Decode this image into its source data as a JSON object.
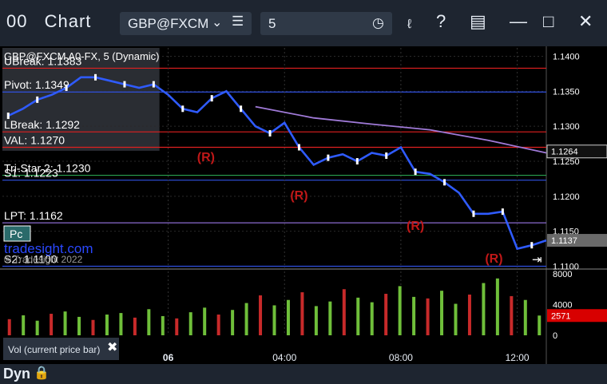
{
  "window": {
    "icon_label": "00",
    "title": "Chart"
  },
  "toolbar": {
    "symbol": "GBP@FXCM",
    "interval": "5"
  },
  "chart_header": {
    "top_line": "GBP@FXCM A0-FX, 5 (Dynamic)",
    "watermark": "tradesight.com",
    "copyright": "© Tradesight 2022",
    "pc_button": "Pc"
  },
  "levels": [
    {
      "label": "UBreak: 1.1383",
      "price": 1.1383,
      "color": "#e02020"
    },
    {
      "label": "Pivot: 1.1349",
      "price": 1.1349,
      "color": "#3050e0"
    },
    {
      "label": "LBreak: 1.1292",
      "price": 1.1292,
      "color": "#e02020"
    },
    {
      "label": "VAL: 1.1270",
      "price": 1.127,
      "color": "#e02020"
    },
    {
      "label": "Tri-Star 2: 1.1230",
      "price": 1.123,
      "color": "#2aa050"
    },
    {
      "label": "S1: 1.1223",
      "price": 1.1223,
      "color": "#3050e0"
    },
    {
      "label": "LPT: 1.1162",
      "price": 1.1162,
      "color": "#8a6ad0"
    },
    {
      "label": "S2: 1.1100",
      "price": 1.11,
      "color": "#3050e0"
    }
  ],
  "chart_data": {
    "type": "line",
    "price_axis": [
      1.14,
      1.135,
      1.13,
      1.125,
      1.12,
      1.115,
      1.11
    ],
    "price_axis_labels": [
      "1.1400",
      "1.1350",
      "1.1300",
      "1.1250",
      "1.1200",
      "1.1150",
      "1.1100"
    ],
    "ylim": [
      1.1096,
      1.1412
    ],
    "x_time_labels": [
      "06",
      "04:00",
      "08:00",
      "12:00"
    ],
    "x_label_hours": [
      0,
      4,
      8,
      12
    ],
    "x_range_hours": [
      -5.7,
      13
    ],
    "series": [
      {
        "values_x": [
          -5.5,
          -5,
          -4.5,
          -4,
          -3.5,
          -3,
          -2.5,
          -2,
          -1.5,
          -1,
          -0.5,
          0,
          0.5,
          1,
          1.5,
          2,
          2.5,
          3,
          3.5,
          4,
          4.5,
          5,
          5.5,
          6,
          6.5,
          7,
          7.5,
          8,
          8.5,
          9,
          9.5,
          10,
          10.5,
          11,
          11.5,
          12,
          12.5,
          13
        ],
        "values": [
          1.1315,
          1.1325,
          1.1338,
          1.1345,
          1.1355,
          1.137,
          1.137,
          1.1365,
          1.136,
          1.1355,
          1.136,
          1.1345,
          1.1325,
          1.132,
          1.134,
          1.135,
          1.1325,
          1.13,
          1.129,
          1.1305,
          1.127,
          1.1245,
          1.1255,
          1.126,
          1.125,
          1.1262,
          1.1258,
          1.127,
          1.1235,
          1.1232,
          1.122,
          1.1205,
          1.1175,
          1.1175,
          1.1178,
          1.1125,
          1.113,
          1.1137
        ]
      },
      {
        "values_x": [
          3,
          5,
          7,
          9,
          11,
          13
        ],
        "values": [
          1.1328,
          1.1312,
          1.1303,
          1.1295,
          1.128,
          1.1262
        ]
      }
    ],
    "current_price": 1.1137,
    "current_price_label": "1.1137",
    "marker_price": 1.1264,
    "marker_price_label": "1.1264",
    "r_markers": [
      {
        "x": 1.3,
        "y": 1.125,
        "label": "(R)"
      },
      {
        "x": 4.5,
        "y": 1.1195,
        "label": "(R)"
      },
      {
        "x": 8.5,
        "y": 1.1152,
        "label": "(R)"
      },
      {
        "x": 11.2,
        "y": 1.1105,
        "label": "(R)"
      }
    ],
    "volume_axis_labels": [
      "8000",
      "4000",
      "0"
    ],
    "volume_axis_values": [
      8000,
      4000,
      0
    ],
    "volume_current": 2571,
    "volume_current_label": "2571",
    "volume_max": 8000,
    "volumes": [
      2100,
      2600,
      1900,
      2800,
      3100,
      2400,
      2000,
      2700,
      2900,
      2300,
      3400,
      2500,
      2200,
      3000,
      3600,
      2700,
      3300,
      4200,
      5200,
      3900,
      4600,
      5600,
      3800,
      4400,
      6000,
      4900,
      4300,
      5400,
      6400,
      5000,
      4800,
      5800,
      4100,
      5300,
      6800,
      7400,
      5100,
      4600,
      2571
    ],
    "bar_count": 39
  },
  "legend": {
    "vol_label": "Vol (current price bar)"
  },
  "status": {
    "mode": "Dyn"
  }
}
